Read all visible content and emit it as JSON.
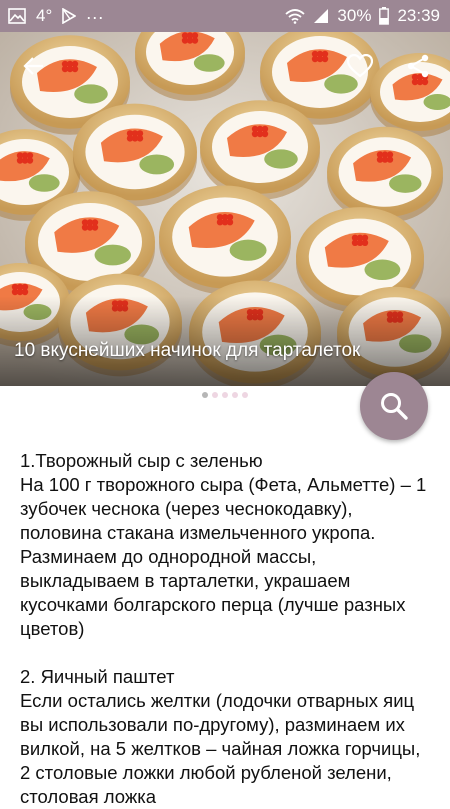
{
  "status_bar": {
    "notification_count": "4°",
    "battery": "30%",
    "time": "23:39",
    "more": "..."
  },
  "hero": {
    "title": "10 вкуснейших начинок для тарталеток",
    "page_count": 5,
    "active_page": 1
  },
  "article": {
    "sections": [
      {
        "heading": "1.Творожный сыр с зеленью",
        "body": "На 100 г творожного сыра (Фета, Альметте) – 1 зубочек чеснока (через чеснокодавку), половина стакана измельченного укропа. Разминаем до однородной массы, выкладываем в тарталетки, украшаем кусочками болгарского перца (лучше разных цветов)"
      },
      {
        "heading": "2. Яичный паштет",
        "body": "Если остались желтки (лодочки отварных яиц вы использовали по-другому), разминаем их вилкой, на 5 желтков – чайная ложка горчицы, 2 столовые ложки любой рубленой зелени, столовая ложка"
      }
    ]
  },
  "icons": {
    "back": "arrow-left-icon",
    "favorite": "heart-outline-icon",
    "share": "share-icon",
    "search": "search-icon"
  },
  "colors": {
    "status_bar": "#9c8794",
    "fab": "#9d8693",
    "indicator_dot": "#eed6e2"
  }
}
